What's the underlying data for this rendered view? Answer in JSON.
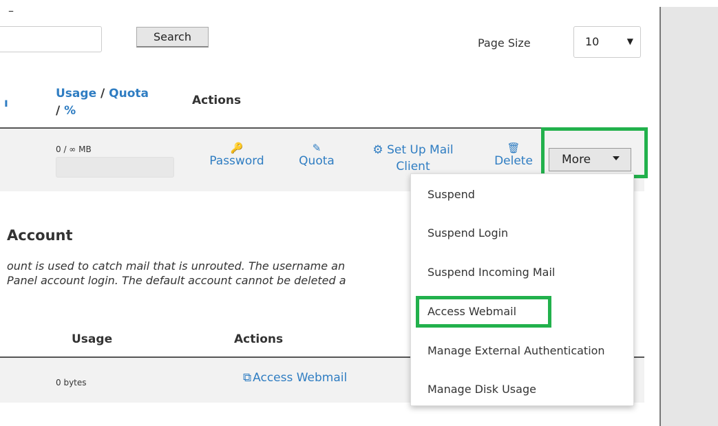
{
  "top": {
    "dash": "–"
  },
  "search": {
    "placeholder": "",
    "button_label": "Search"
  },
  "page_size": {
    "label": "Page Size",
    "value": "10"
  },
  "table1": {
    "headers": {
      "partial": "ı",
      "usage_label": "Usage",
      "slash1": " / ",
      "quota_label": "Quota",
      "slash2": "/ ",
      "percent_label": "%",
      "actions": "Actions"
    },
    "row": {
      "usage_text": "0 / ∞ MB",
      "actions": {
        "password": {
          "icon": "key-icon",
          "glyph": "🔑",
          "label": "Password"
        },
        "quota": {
          "icon": "pencil-icon",
          "glyph": "✎",
          "label": "Quota"
        },
        "setup": {
          "icon": "gear-icon",
          "glyph": "⚙",
          "label_line1": "Set Up Mail",
          "label_line2": "Client"
        },
        "delete": {
          "icon": "trash-icon",
          "glyph": "🗑",
          "label": "Delete"
        }
      },
      "more_label": "More"
    }
  },
  "default_account": {
    "title": "Account",
    "desc_line1": "ount is used to catch mail that is unrouted. The username an",
    "desc_line2": "Panel account login. The default account cannot be deleted a"
  },
  "table2": {
    "headers": {
      "usage": "Usage",
      "actions": "Actions"
    },
    "row": {
      "usage_value": "0 bytes",
      "webmail_icon": "external-link-icon",
      "webmail_glyph": "⧉",
      "webmail_label": "Access Webmail"
    }
  },
  "dropdown": {
    "items": [
      "Suspend",
      "Suspend Login",
      "Suspend Incoming Mail",
      "Access Webmail",
      "Manage External Authentication",
      "Manage Disk Usage"
    ]
  },
  "colors": {
    "link": "#2f7dc2",
    "highlight": "#22b14c",
    "row_bg": "#f2f2f2"
  }
}
